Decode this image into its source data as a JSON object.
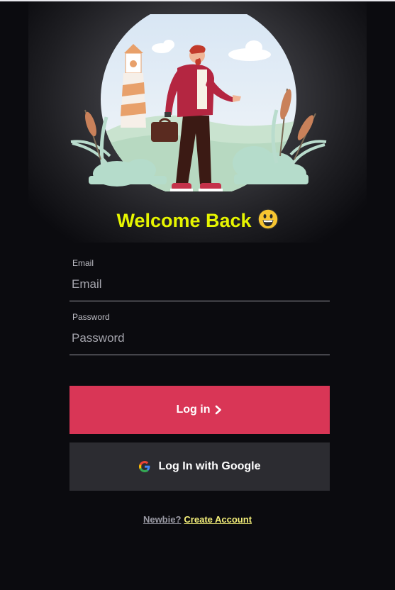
{
  "heading": {
    "title": "Welcome Back",
    "emoji_icon": "grinning-face-icon"
  },
  "form": {
    "email": {
      "label": "Email",
      "placeholder": "Email",
      "value": ""
    },
    "password": {
      "label": "Password",
      "placeholder": "Password",
      "value": ""
    }
  },
  "buttons": {
    "login_label": "Log in",
    "login_icon": "chevron-right-icon",
    "google_label": "Log In with Google",
    "google_icon": "google-logo-icon"
  },
  "footer": {
    "question": "Newbie?",
    "link_label": "Create Account"
  },
  "colors": {
    "background": "#0b0b0f",
    "title": "#e6f500",
    "login_button": "#d93656",
    "google_button": "#2c2c31",
    "link": "#f5f07a"
  }
}
